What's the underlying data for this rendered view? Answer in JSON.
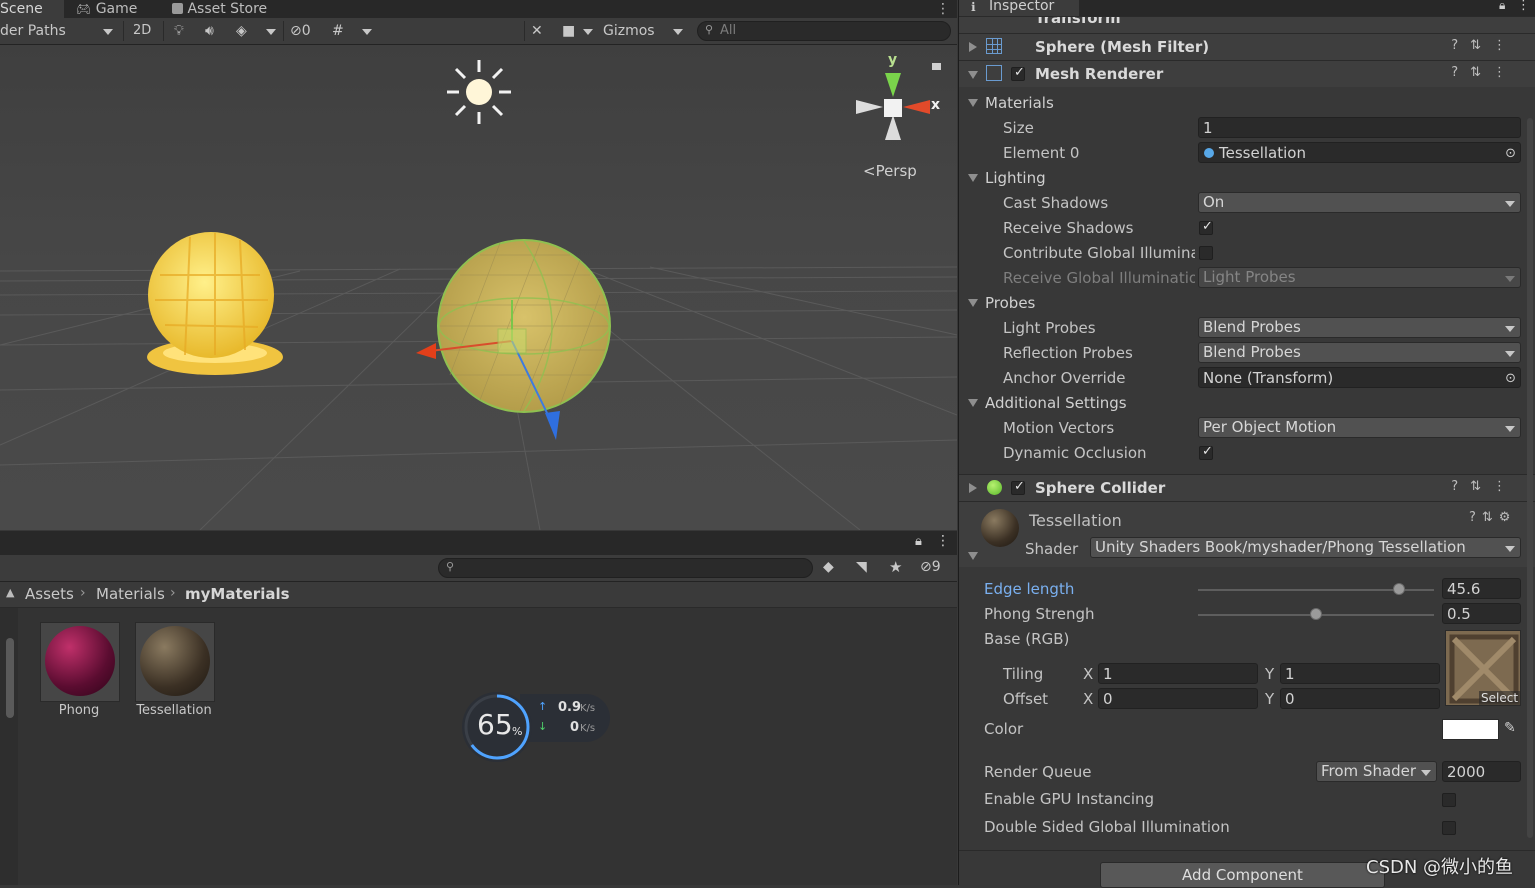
{
  "scene_tabs": {
    "scene": "Scene",
    "game": "Game",
    "asset_store": "Asset Store"
  },
  "scene_toolbar": {
    "render_paths": "der Paths",
    "mode_2d": "2D",
    "hidden_count": "0",
    "gizmos": "Gizmos",
    "search_placeholder": "All"
  },
  "scene_view": {
    "persp_label": "<Persp",
    "axis_y": "y",
    "axis_x": "x"
  },
  "project": {
    "hidden_count": "9",
    "breadcrumb": [
      "Assets",
      "Materials",
      "myMaterials"
    ],
    "assets": [
      {
        "name": "Phong",
        "color": "#7a1a4a"
      },
      {
        "name": "Tessellation",
        "color": "#4f4538"
      }
    ]
  },
  "network_widget": {
    "percent": "65",
    "percent_sign": "%",
    "up": "0.9",
    "up_unit": "K/s",
    "down": "0",
    "down_unit": "K/s"
  },
  "inspector": {
    "tab_title": "Inspector",
    "transform_title": "Transform",
    "mesh_filter_title": "Sphere (Mesh Filter)",
    "mesh_renderer_title": "Mesh Renderer",
    "materials": {
      "header": "Materials",
      "size_label": "Size",
      "size_value": "1",
      "element0_label": "Element 0",
      "element0_value": "Tessellation"
    },
    "lighting": {
      "header": "Lighting",
      "cast_shadows_label": "Cast Shadows",
      "cast_shadows_value": "On",
      "receive_shadows_label": "Receive Shadows",
      "contribute_gi_label": "Contribute Global Illuminati",
      "receive_gi_label": "Receive Global Illuminatior",
      "receive_gi_value": "Light Probes"
    },
    "probes": {
      "header": "Probes",
      "light_probes_label": "Light Probes",
      "light_probes_value": "Blend Probes",
      "reflection_probes_label": "Reflection Probes",
      "reflection_probes_value": "Blend Probes",
      "anchor_override_label": "Anchor Override",
      "anchor_override_value": "None (Transform)"
    },
    "additional": {
      "header": "Additional Settings",
      "motion_vectors_label": "Motion Vectors",
      "motion_vectors_value": "Per Object Motion",
      "dynamic_occlusion_label": "Dynamic Occlusion"
    },
    "sphere_collider_title": "Sphere Collider",
    "material": {
      "name": "Tessellation",
      "shader_label": "Shader",
      "shader_value": "Unity Shaders Book/myshader/Phong Tessellation",
      "edge_length_label": "Edge length",
      "edge_length_value": "45.6",
      "edge_length_fraction": 0.87,
      "phong_strength_label": "Phong Strengh",
      "phong_strength_value": "0.5",
      "phong_strength_fraction": 0.5,
      "base_rgb_label": "Base (RGB)",
      "tiling_label": "Tiling",
      "tiling_x": "1",
      "tiling_y": "1",
      "offset_label": "Offset",
      "offset_x": "0",
      "offset_y": "0",
      "x_label": "X",
      "y_label": "Y",
      "select_label": "Select",
      "color_label": "Color",
      "color_value": "#ffffff",
      "render_queue_label": "Render Queue",
      "render_queue_mode": "From Shader",
      "render_queue_value": "2000",
      "gpu_instancing_label": "Enable GPU Instancing",
      "double_sided_gi_label": "Double Sided Global Illumination"
    },
    "add_component": "Add Component"
  },
  "watermark": "CSDN @微小的鱼"
}
